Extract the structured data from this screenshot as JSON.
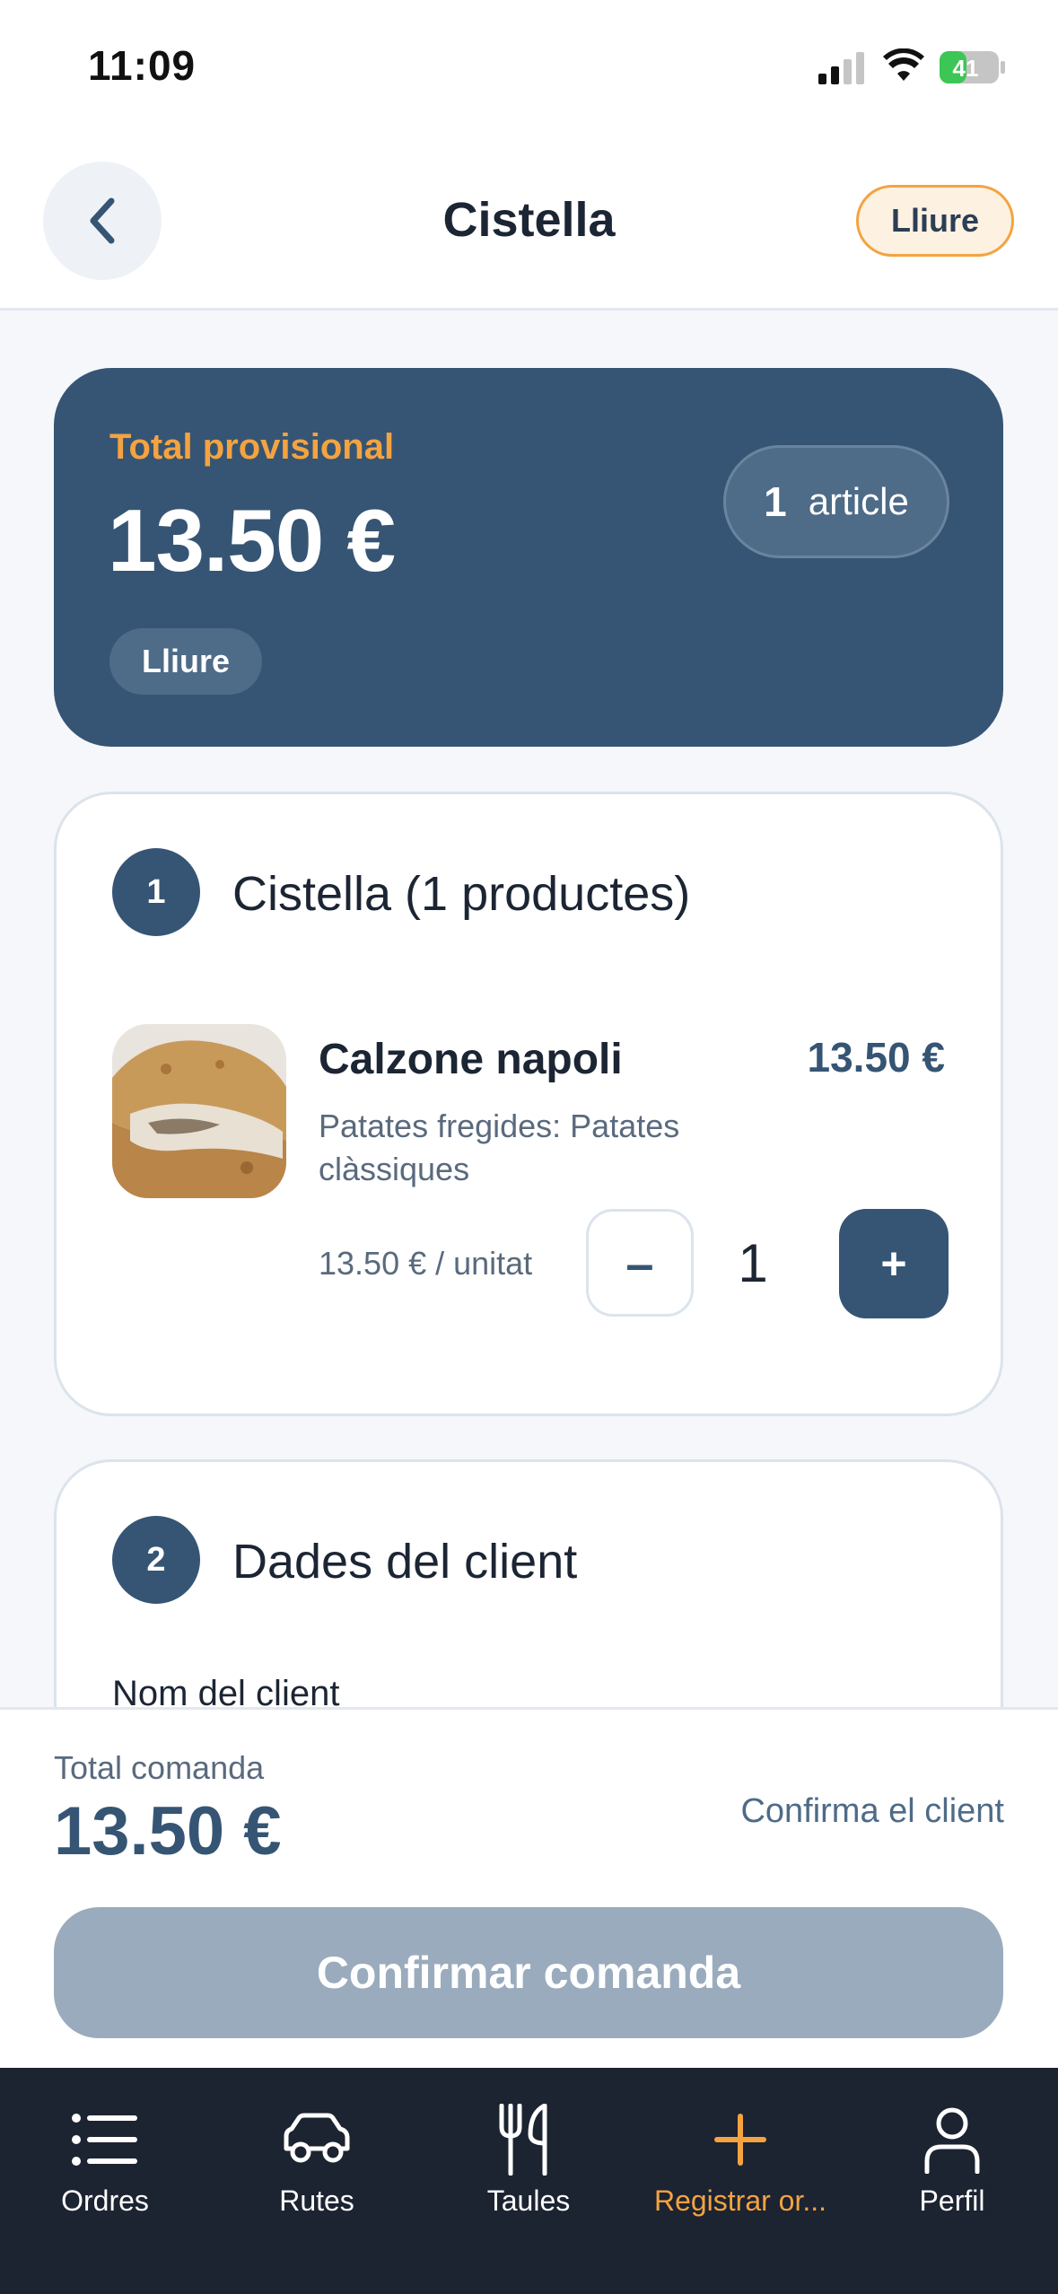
{
  "status_bar": {
    "time": "11:09",
    "battery": "41"
  },
  "header": {
    "title": "Cistella",
    "status_pill": "Lliure"
  },
  "summary": {
    "label": "Total provisional",
    "total": "13.50 €",
    "count_number": "1",
    "count_label": "article",
    "badge": "Lliure"
  },
  "cart_section": {
    "step": "1",
    "title": "Cistella (1 productes)",
    "items": [
      {
        "name": "Calzone napoli",
        "price": "13.50 €",
        "option": "Patates fregides: Patates clàssiques",
        "unit_price": "13.50 € / unitat",
        "quantity": "1",
        "minus_label": "–",
        "plus_label": "+"
      }
    ]
  },
  "client_section": {
    "step": "2",
    "title": "Dades del client",
    "name_label": "Nom del client"
  },
  "footer": {
    "total_label": "Total comanda",
    "total": "13.50 €",
    "hint": "Confirma el client",
    "confirm_button": "Confirmar comanda"
  },
  "tabbar": {
    "tabs": [
      {
        "label": "Ordres",
        "icon": "list-icon"
      },
      {
        "label": "Rutes",
        "icon": "car-icon"
      },
      {
        "label": "Taules",
        "icon": "fork-knife-icon"
      },
      {
        "label": "Registrar or...",
        "icon": "plus-icon",
        "active": true
      },
      {
        "label": "Perfil",
        "icon": "person-icon"
      }
    ]
  },
  "colors": {
    "primary": "#365574",
    "accent": "#f4a340",
    "disabled": "#9aabbd",
    "tabbar": "#1c2331"
  }
}
